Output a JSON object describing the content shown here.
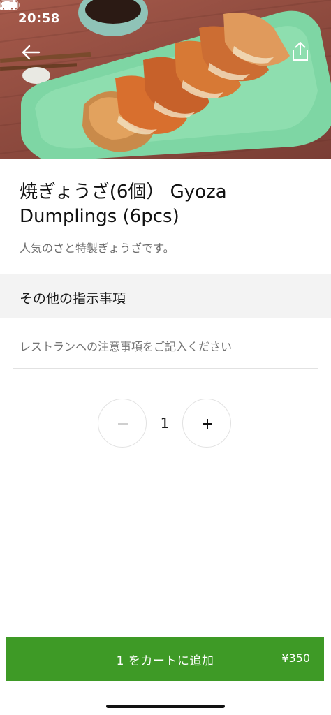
{
  "status_bar": {
    "time": "20:58"
  },
  "hero": {
    "image_subject": "gyoza dumplings on green plate"
  },
  "item": {
    "title": "焼ぎょうざ(6個） Gyoza Dumplings (6pcs)",
    "description": "人気のさと特製ぎょうざです。"
  },
  "instructions": {
    "header": "その他の指示事項",
    "placeholder": "レストランへの注意事項をご記入ください",
    "value": ""
  },
  "quantity": {
    "value": "1",
    "minus_symbol": "−",
    "plus_symbol": "+"
  },
  "cart": {
    "label": "1 をカートに追加",
    "price": "¥350"
  },
  "colors": {
    "accent_green": "#3e9a26",
    "plate_green": "#7ed6a4",
    "hero_background": "#8d4a3e"
  },
  "icons": {
    "back": "arrow-left-icon",
    "share": "share-icon",
    "location": "location-arrow-icon",
    "signal": "cellular-signal-icon",
    "wifi": "wifi-icon",
    "battery": "battery-icon"
  }
}
